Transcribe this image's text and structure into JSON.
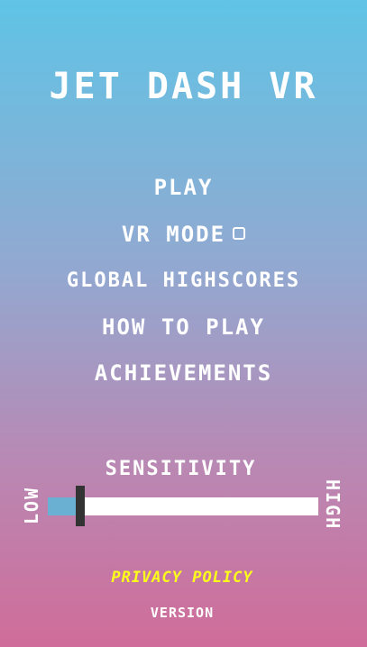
{
  "app": {
    "title": "JET DASH VR"
  },
  "menu": {
    "play": "PLAY",
    "vr_mode": "VR MODE",
    "global_highscores": "GLOBAL HIGHSCORES",
    "how_to_play": "HOW TO PLAY",
    "achievements": "ACHIEVEMENTS"
  },
  "vr_mode_checked": false,
  "sensitivity": {
    "label": "SENSITIVITY",
    "low_label": "LOW",
    "high_label": "HIGH",
    "value_fraction": 0.12
  },
  "footer": {
    "privacy_policy": "PRIVACY POLICY",
    "version": "VERSION"
  },
  "colors": {
    "gradient_top": "#5fc4e6",
    "gradient_bottom": "#d06c99",
    "privacy_link": "#ffff1a",
    "slider_fill": "#6ab0d2",
    "slider_handle": "#333333"
  },
  "icons": {
    "vr_mode_toggle": "hexagon-checkbox-icon"
  }
}
